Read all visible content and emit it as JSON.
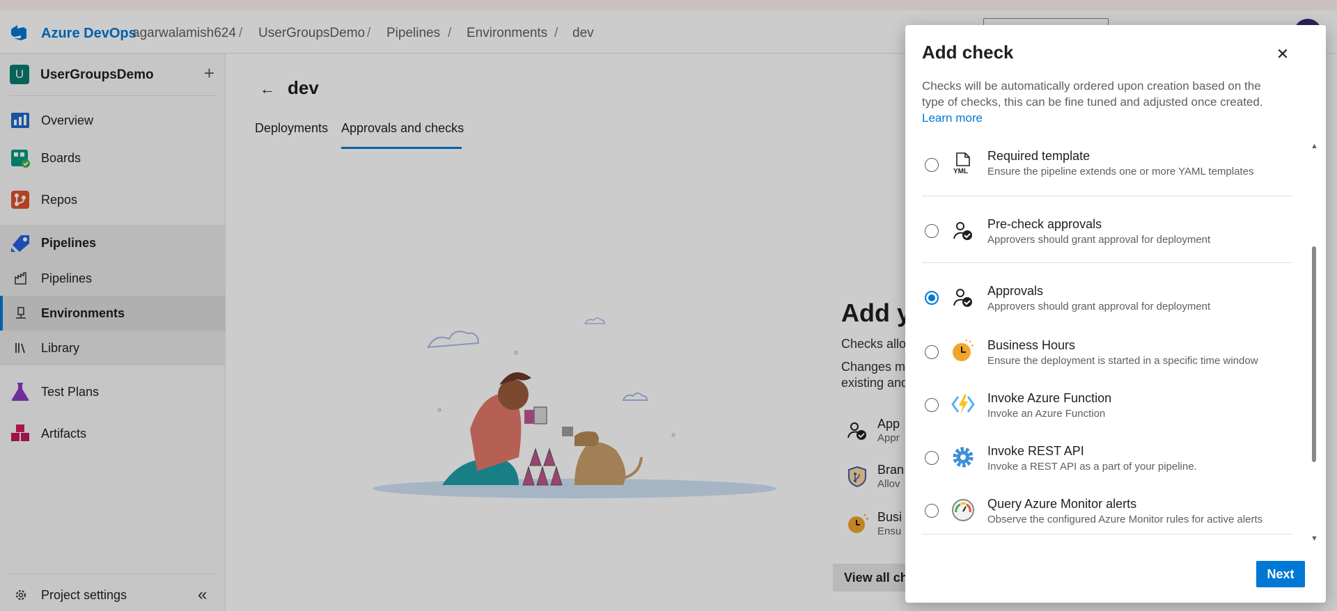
{
  "header": {
    "brand": "Azure DevOps",
    "breadcrumbs": [
      "agarwalamish624",
      "UserGroupsDemo",
      "Pipelines",
      "Environments",
      "dev"
    ],
    "separator": "/"
  },
  "sidebar": {
    "project_initial": "U",
    "project_name": "UserGroupsDemo",
    "add_glyph": "+",
    "items": [
      {
        "label": "Overview",
        "icon": "overview-icon"
      },
      {
        "label": "Boards",
        "icon": "boards-icon"
      },
      {
        "label": "Repos",
        "icon": "repos-icon"
      },
      {
        "label": "Pipelines",
        "icon": "pipelines-icon"
      },
      {
        "label": "Pipelines",
        "icon": "pipelines-sub-icon"
      },
      {
        "label": "Environments",
        "icon": "environments-icon"
      },
      {
        "label": "Library",
        "icon": "library-icon"
      },
      {
        "label": "Test Plans",
        "icon": "test-plans-icon"
      },
      {
        "label": "Artifacts",
        "icon": "artifacts-icon"
      }
    ],
    "settings_label": "Project settings",
    "collapse_glyph": "«"
  },
  "main": {
    "back_glyph": "←",
    "title": "dev",
    "tabs": [
      {
        "label": "Deployments",
        "selected": false
      },
      {
        "label": "Approvals and checks",
        "selected": true
      }
    ],
    "empty": {
      "heading": "Add y",
      "line1": "Checks allov",
      "line2": "Changes ma",
      "line3": "existing and",
      "checks": [
        {
          "t1": "App",
          "t2": "Appr"
        },
        {
          "t1": "Bran",
          "t2": "Allov"
        },
        {
          "t1": "Busi",
          "t2": "Ensu"
        }
      ],
      "view_all": "View all checks"
    }
  },
  "panel": {
    "title": "Add check",
    "close_glyph": "✕",
    "description": "Checks will be automatically ordered upon creation based on the type of checks, this can be fine tuned and adjusted once created.",
    "learn_more": "Learn more",
    "checks": [
      {
        "name": "Required template",
        "description": "Ensure the pipeline extends one or more YAML templates",
        "icon": "yaml-template-icon",
        "selected": false
      },
      {
        "name": "Pre-check approvals",
        "description": "Approvers should grant approval for deployment",
        "icon": "approver-icon",
        "selected": false
      },
      {
        "name": "Approvals",
        "description": "Approvers should grant approval for deployment",
        "icon": "approver-icon",
        "selected": true
      },
      {
        "name": "Business Hours",
        "description": "Ensure the deployment is started in a specific time window",
        "icon": "clock-icon",
        "selected": false
      },
      {
        "name": "Invoke Azure Function",
        "description": "Invoke an Azure Function",
        "icon": "azure-function-icon",
        "selected": false
      },
      {
        "name": "Invoke REST API",
        "description": "Invoke a REST API as a part of your pipeline.",
        "icon": "gear-icon",
        "selected": false
      },
      {
        "name": "Query Azure Monitor alerts",
        "description": "Observe the configured Azure Monitor rules for active alerts",
        "icon": "monitor-gauge-icon",
        "selected": false
      }
    ],
    "next_label": "Next"
  },
  "colors": {
    "accent": "#0078d4",
    "project_badge": "#0a7b6e"
  }
}
